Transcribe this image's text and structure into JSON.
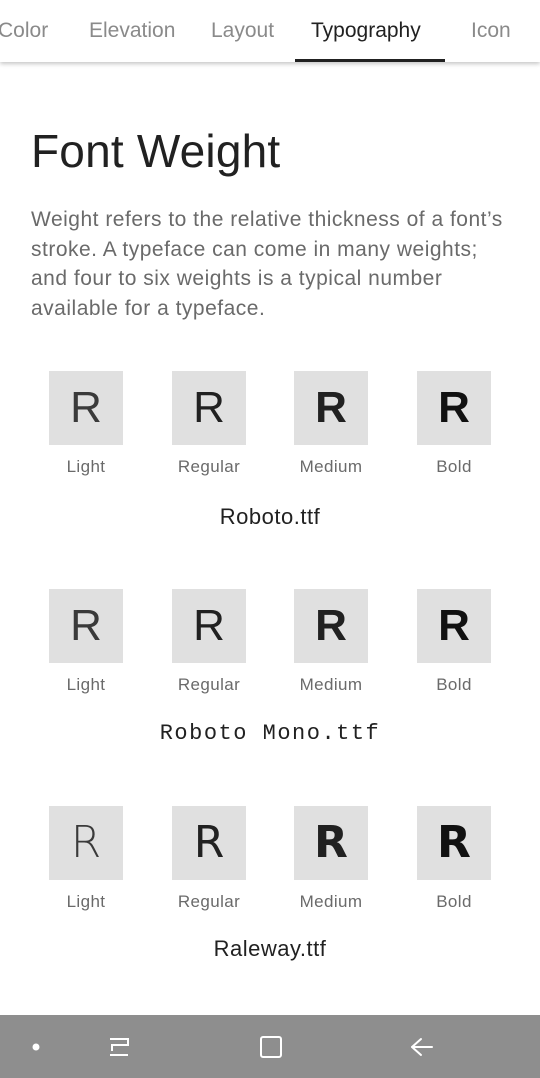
{
  "tabs": [
    {
      "label": "Color",
      "active": false
    },
    {
      "label": "Elevation",
      "active": false
    },
    {
      "label": "Layout",
      "active": false
    },
    {
      "label": "Typography",
      "active": true
    },
    {
      "label": "Icon",
      "active": false
    }
  ],
  "title": "Font Weight",
  "description": "Weight refers to the relative thickness of a font’s stroke. A typeface can come in many weights; and four to six weights is a typical number available for a typeface.",
  "fonts": [
    {
      "name": "Roboto.ttf",
      "samples": [
        {
          "glyph": "R",
          "label": "Light"
        },
        {
          "glyph": "R",
          "label": "Regular"
        },
        {
          "glyph": "R",
          "label": "Medium"
        },
        {
          "glyph": "R",
          "label": "Bold"
        }
      ]
    },
    {
      "name": "Roboto Mono.ttf",
      "samples": [
        {
          "glyph": "R",
          "label": "Light"
        },
        {
          "glyph": "R",
          "label": "Regular"
        },
        {
          "glyph": "R",
          "label": "Medium"
        },
        {
          "glyph": "R",
          "label": "Bold"
        }
      ]
    },
    {
      "name": "Raleway.ttf",
      "samples": [
        {
          "glyph": "R",
          "label": "Light"
        },
        {
          "glyph": "R",
          "label": "Regular"
        },
        {
          "glyph": "R",
          "label": "Medium"
        },
        {
          "glyph": "R",
          "label": "Bold"
        }
      ]
    }
  ],
  "navbar": {
    "icons": [
      "dot-icon",
      "recent-apps-icon",
      "home-icon",
      "back-icon"
    ]
  },
  "colors": {
    "swatch_background": "#e0e0e0",
    "tab_inactive": "#8a8a8a",
    "tab_active": "#212121",
    "navbar_background": "#8e8e8e"
  }
}
